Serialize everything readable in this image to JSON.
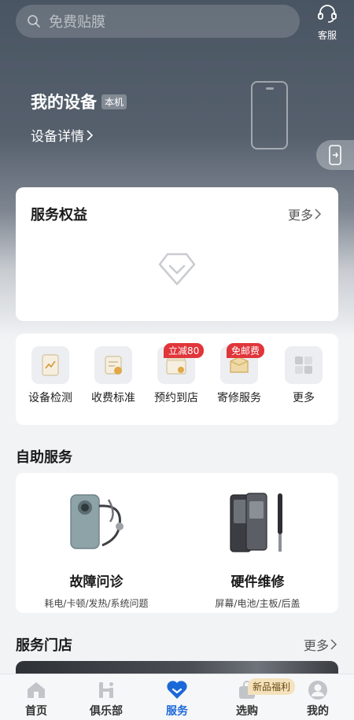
{
  "search": {
    "placeholder": "免费贴膜"
  },
  "customer_service": {
    "label": "客服"
  },
  "device": {
    "title": "我的设备",
    "badge": "本机",
    "detail": "设备详情"
  },
  "rights": {
    "title": "服务权益",
    "more": "更多"
  },
  "services": [
    {
      "label": "设备检测",
      "tag": ""
    },
    {
      "label": "收费标准",
      "tag": ""
    },
    {
      "label": "预约到店",
      "tag": "立减80"
    },
    {
      "label": "寄修服务",
      "tag": "免邮费"
    },
    {
      "label": "更多",
      "tag": ""
    }
  ],
  "self_service": {
    "title": "自助服务",
    "items": [
      {
        "title": "故障问诊",
        "subtitle": "耗电/卡顿/发热/系统问题"
      },
      {
        "title": "硬件维修",
        "subtitle": "屏幕/电池/主板/后盖"
      }
    ]
  },
  "stores": {
    "title": "服务门店",
    "more": "更多"
  },
  "tabbar": {
    "new_tag": "新品福利",
    "tabs": [
      {
        "label": "首页"
      },
      {
        "label": "俱乐部"
      },
      {
        "label": "服务"
      },
      {
        "label": "选购"
      },
      {
        "label": "我的"
      }
    ]
  },
  "colors": {
    "accent": "#1b68d9",
    "tag_red": "#e0353a",
    "hero_top": "#4a5563"
  }
}
